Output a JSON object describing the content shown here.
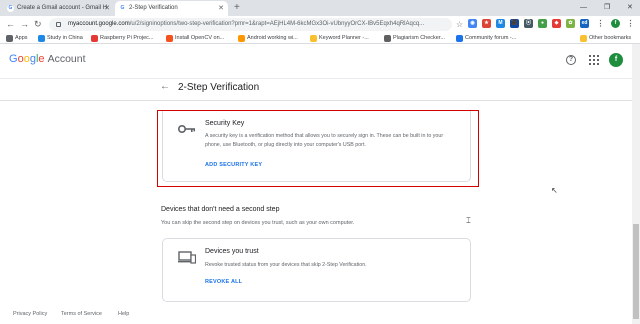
{
  "tabs": [
    {
      "title": "Create a Gmail account - Gmail H",
      "favicon": "G"
    },
    {
      "title": "2-Step Verification",
      "favicon": "G"
    }
  ],
  "address_bar": {
    "host": "myaccount.google.com",
    "path": "/u/2/signinoptions/two-step-verification?pmr=1&rapt=AEjHL4M-6kcMGx3Oi-vUbnyyOrCX-IBv5Eqxh4qRlAqcq..."
  },
  "bookmarks": [
    {
      "label": "Apps",
      "color": "#5f6368"
    },
    {
      "label": "Study in China",
      "color": "#1e88e5"
    },
    {
      "label": "Raspberry Pi Projec...",
      "color": "#e53935"
    },
    {
      "label": "Install OpenCV on...",
      "color": "#f4511e"
    },
    {
      "label": "Android working wi...",
      "color": "#ff9800"
    },
    {
      "label": "Keyword Planner -...",
      "color": "#fbc02d"
    },
    {
      "label": "Plagiarism Checker...",
      "color": "#616161"
    },
    {
      "label": "Community forum -...",
      "color": "#1a73e8"
    },
    {
      "label": "Other bookmarks",
      "color": "#fbc02d"
    }
  ],
  "header": {
    "logo_google": "Google",
    "logo_account": "Account",
    "avatar_letter": "f"
  },
  "subheader": {
    "title": "2-Step Verification"
  },
  "security_key": {
    "title": "Security Key",
    "description": "A security key is a verification method that allows you to securely sign in. These can be built in to your phone, use Bluetooth, or plug directly into your computer's USB port.",
    "link": "ADD SECURITY KEY"
  },
  "devices_section": {
    "title": "Devices that don't need a second step",
    "description": "You can skip the second step on devices you trust, such as your own computer."
  },
  "devices_trust": {
    "title": "Devices you trust",
    "description": "Revoke trusted status from your devices that skip 2-Step Verification.",
    "link": "REVOKE ALL"
  },
  "footer": {
    "privacy": "Privacy Policy",
    "terms": "Terms of Service",
    "help": "Help"
  },
  "colors": {
    "accent": "#1a73e8",
    "highlight": "#d50000",
    "avatar": "#1e8e3e"
  }
}
